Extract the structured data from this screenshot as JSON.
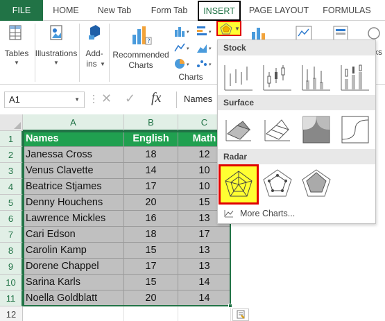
{
  "tabs": {
    "file": "FILE",
    "home": "HOME",
    "new_tab": "New Tab",
    "form_tab": "Form Tab",
    "insert": "INSERT",
    "page_layout": "PAGE LAYOUT",
    "formulas": "FORMULAS"
  },
  "ribbon": {
    "tables_label": "Tables",
    "illustrations_label": "Illustrations",
    "addins_label": "Add-\nins",
    "addins_line1": "Add-",
    "addins_line2": "ins",
    "recommended_line1": "Recommended",
    "recommended_line2": "Charts",
    "charts_group_label": "Charts",
    "partial_label": "ks"
  },
  "formula_bar": {
    "name_box": "A1",
    "fx": "fx",
    "content": "Names"
  },
  "columns": [
    "A",
    "B",
    "C"
  ],
  "rows": [
    "1",
    "2",
    "3",
    "4",
    "5",
    "6",
    "7",
    "8",
    "9",
    "10",
    "11",
    "12"
  ],
  "table": {
    "headers": [
      "Names",
      "English",
      "Math"
    ],
    "rows": [
      [
        "Janessa Cross",
        "18",
        "12"
      ],
      [
        "Venus Clavette",
        "14",
        "10"
      ],
      [
        "Beatrice Stjames",
        "17",
        "10"
      ],
      [
        "Denny Houchens",
        "20",
        "15"
      ],
      [
        "Lawrence Mickles",
        "16",
        "13"
      ],
      [
        "Cari Edson",
        "18",
        "17"
      ],
      [
        "Carolin Kamp",
        "15",
        "13"
      ],
      [
        "Dorene Chappel",
        "17",
        "13"
      ],
      [
        "Sarina Karls",
        "15",
        "14"
      ],
      [
        "Noella Goldblatt",
        "20",
        "14"
      ]
    ],
    "header_color": "#20a050",
    "data_fill": "#c0c0c0"
  },
  "dropdown": {
    "stock_header": "Stock",
    "surface_header": "Surface",
    "radar_header": "Radar",
    "more_charts": "More Charts...",
    "selected_highlight": "#ffff32",
    "selected_border": "#e00000"
  },
  "colors": {
    "accent": "#217346",
    "insert_tab_border": "#000000"
  }
}
